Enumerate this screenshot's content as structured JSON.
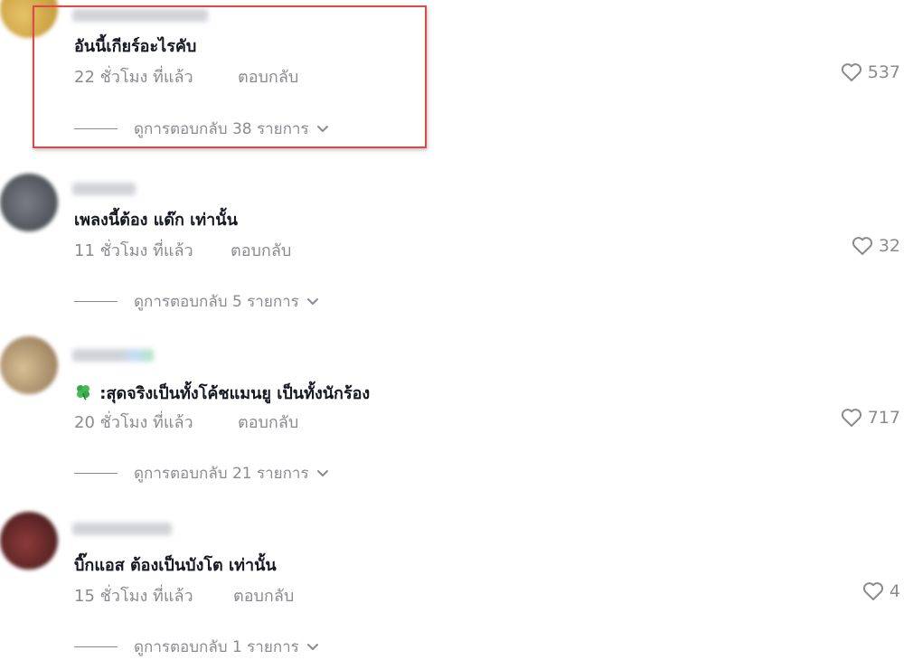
{
  "comments": [
    {
      "text": "อันนี้เกียร์อะไรคับ",
      "time": "22 ชั่วโมง ที่แล้ว",
      "reply_label": "ตอบกลับ",
      "likes": "537",
      "view_replies": "ดูการตอบกลับ 38 รายการ",
      "avatar_color": "#d9b24e"
    },
    {
      "text": "เพลงนี้ต้อง แด๊ก เท่านั้น",
      "time": "11 ชั่วโมง ที่แล้ว",
      "reply_label": "ตอบกลับ",
      "likes": "32",
      "view_replies": "ดูการตอบกลับ 5 รายการ",
      "avatar_color": "#5b5e66"
    },
    {
      "text": ":สุดจริงเป็นทั้งโค้ชแมนยู เป็นทั้งนักร้อง",
      "time": "20 ชั่วโมง ที่แล้ว",
      "reply_label": "ตอบกลับ",
      "likes": "717",
      "view_replies": "ดูการตอบกลับ 21 รายการ",
      "avatar_color": "#b89a74",
      "emoji": "four-leaf-clover-icon"
    },
    {
      "text": "บิ๊กแอส ต้องเป็นบังโต เท่านั้น",
      "time": "15 ชั่วโมง ที่แล้ว",
      "reply_label": "ตอบกลับ",
      "likes": "4",
      "view_replies": "ดูการตอบกลับ 1 รายการ",
      "avatar_color": "#6e2a2a"
    }
  ],
  "colors": {
    "highlight_border": "#e04848",
    "muted_text": "#8a8b91",
    "primary_text": "#161823"
  }
}
